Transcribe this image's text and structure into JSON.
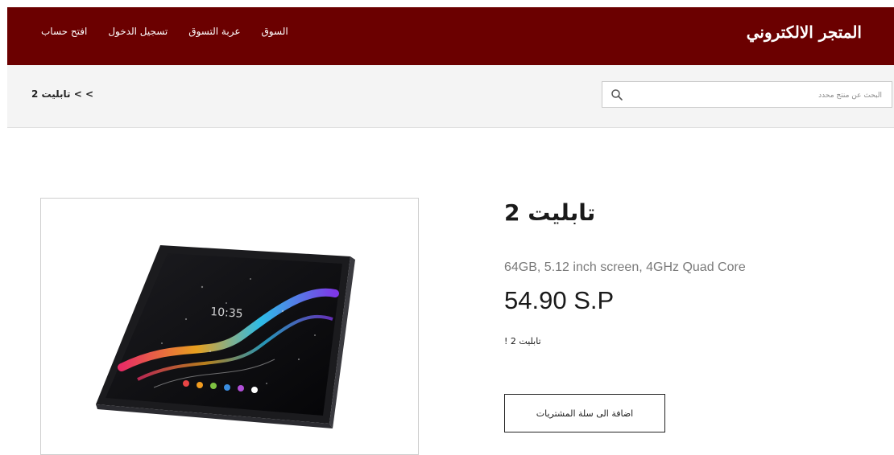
{
  "header": {
    "brand": "المتجر الالكتروني",
    "nav": [
      {
        "label": "السوق"
      },
      {
        "label": "عربة التسوق"
      },
      {
        "label": "تسجيل الدخول"
      },
      {
        "label": "افتح حساب"
      }
    ]
  },
  "subbar": {
    "breadcrumb": "تابليت 2 < <",
    "search": {
      "placeholder": "البحث عن منتج محدد",
      "value": "",
      "icon": "search-icon"
    }
  },
  "product": {
    "title": "تابليت 2",
    "specs": "64GB, 5.12 inch screen, 4GHz Quad Core",
    "price": "54.90 S.P",
    "description": "تابليت 2 !",
    "add_to_cart_label": "اضافة الى سلة المشتريات",
    "image_alt": "tablet"
  },
  "colors": {
    "header_bg": "#6b0000",
    "subbar_bg": "#f4f4f4",
    "header_text": "#ffffff"
  }
}
